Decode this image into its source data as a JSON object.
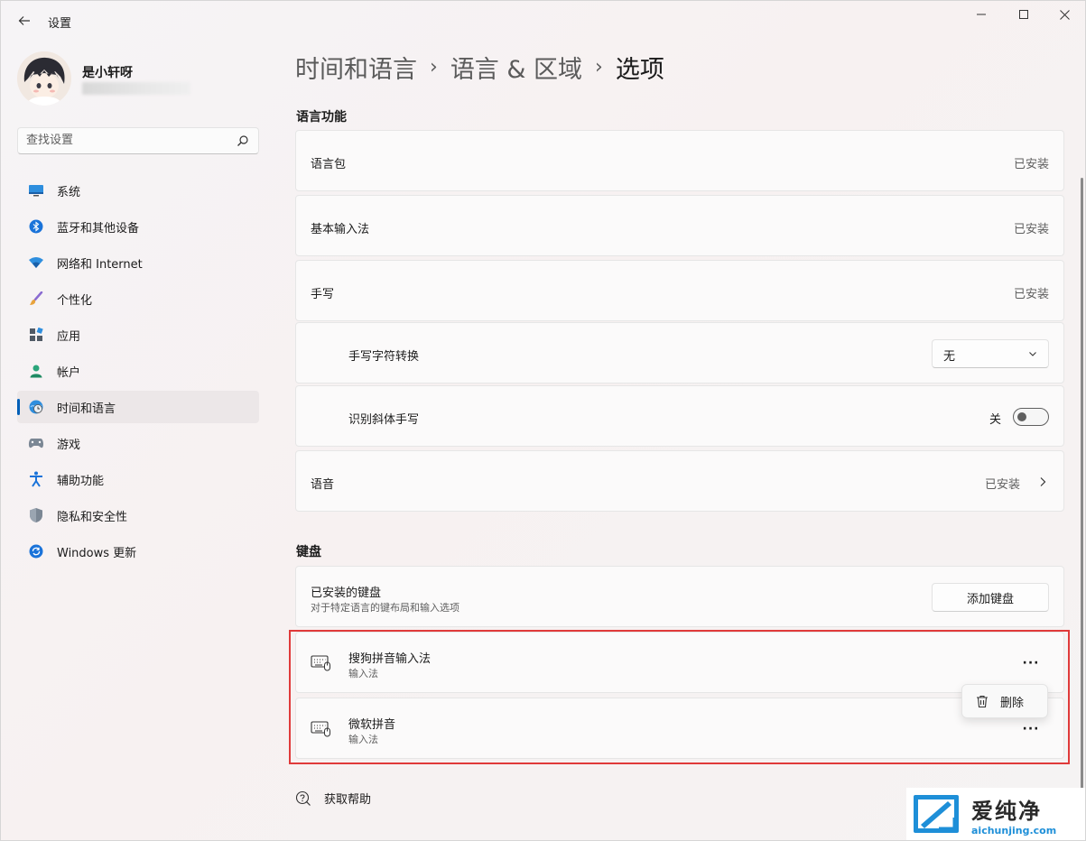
{
  "window": {
    "title": "设置"
  },
  "profile": {
    "name": "是小轩呀"
  },
  "search": {
    "placeholder": "查找设置"
  },
  "nav": {
    "items": [
      {
        "label": "系统"
      },
      {
        "label": "蓝牙和其他设备"
      },
      {
        "label": "网络和 Internet"
      },
      {
        "label": "个性化"
      },
      {
        "label": "应用"
      },
      {
        "label": "帐户"
      },
      {
        "label": "时间和语言"
      },
      {
        "label": "游戏"
      },
      {
        "label": "辅助功能"
      },
      {
        "label": "隐私和安全性"
      },
      {
        "label": "Windows 更新"
      }
    ],
    "active_index": 6
  },
  "breadcrumb": {
    "level1": "时间和语言",
    "level2": "语言 & 区域",
    "current": "选项"
  },
  "language_features": {
    "title": "语言功能",
    "language_pack": {
      "label": "语言包",
      "status": "已安装"
    },
    "basic_typing": {
      "label": "基本输入法",
      "status": "已安装"
    },
    "handwriting": {
      "label": "手写",
      "status": "已安装"
    },
    "handwriting_conversion": {
      "label": "手写字符转换",
      "value": "无"
    },
    "italic_handwriting": {
      "label": "识别斜体手写",
      "state": "关"
    },
    "speech": {
      "label": "语音",
      "status": "已安装"
    }
  },
  "keyboards": {
    "title": "键盘",
    "installed": {
      "label": "已安装的键盘",
      "description": "对于特定语言的键布局和输入选项",
      "add_button": "添加键盘"
    },
    "items": [
      {
        "name": "搜狗拼音输入法",
        "type": "输入法"
      },
      {
        "name": "微软拼音",
        "type": "输入法"
      }
    ],
    "more_label": "···"
  },
  "context_menu": {
    "delete_label": "删除"
  },
  "help": {
    "label": "获取帮助"
  },
  "watermark": {
    "title": "爱纯净",
    "url": "aichunjing.com"
  },
  "colors": {
    "accent": "#005fb8",
    "highlight_border": "#e03a3a",
    "watermark_blue": "#1e8fd8"
  }
}
